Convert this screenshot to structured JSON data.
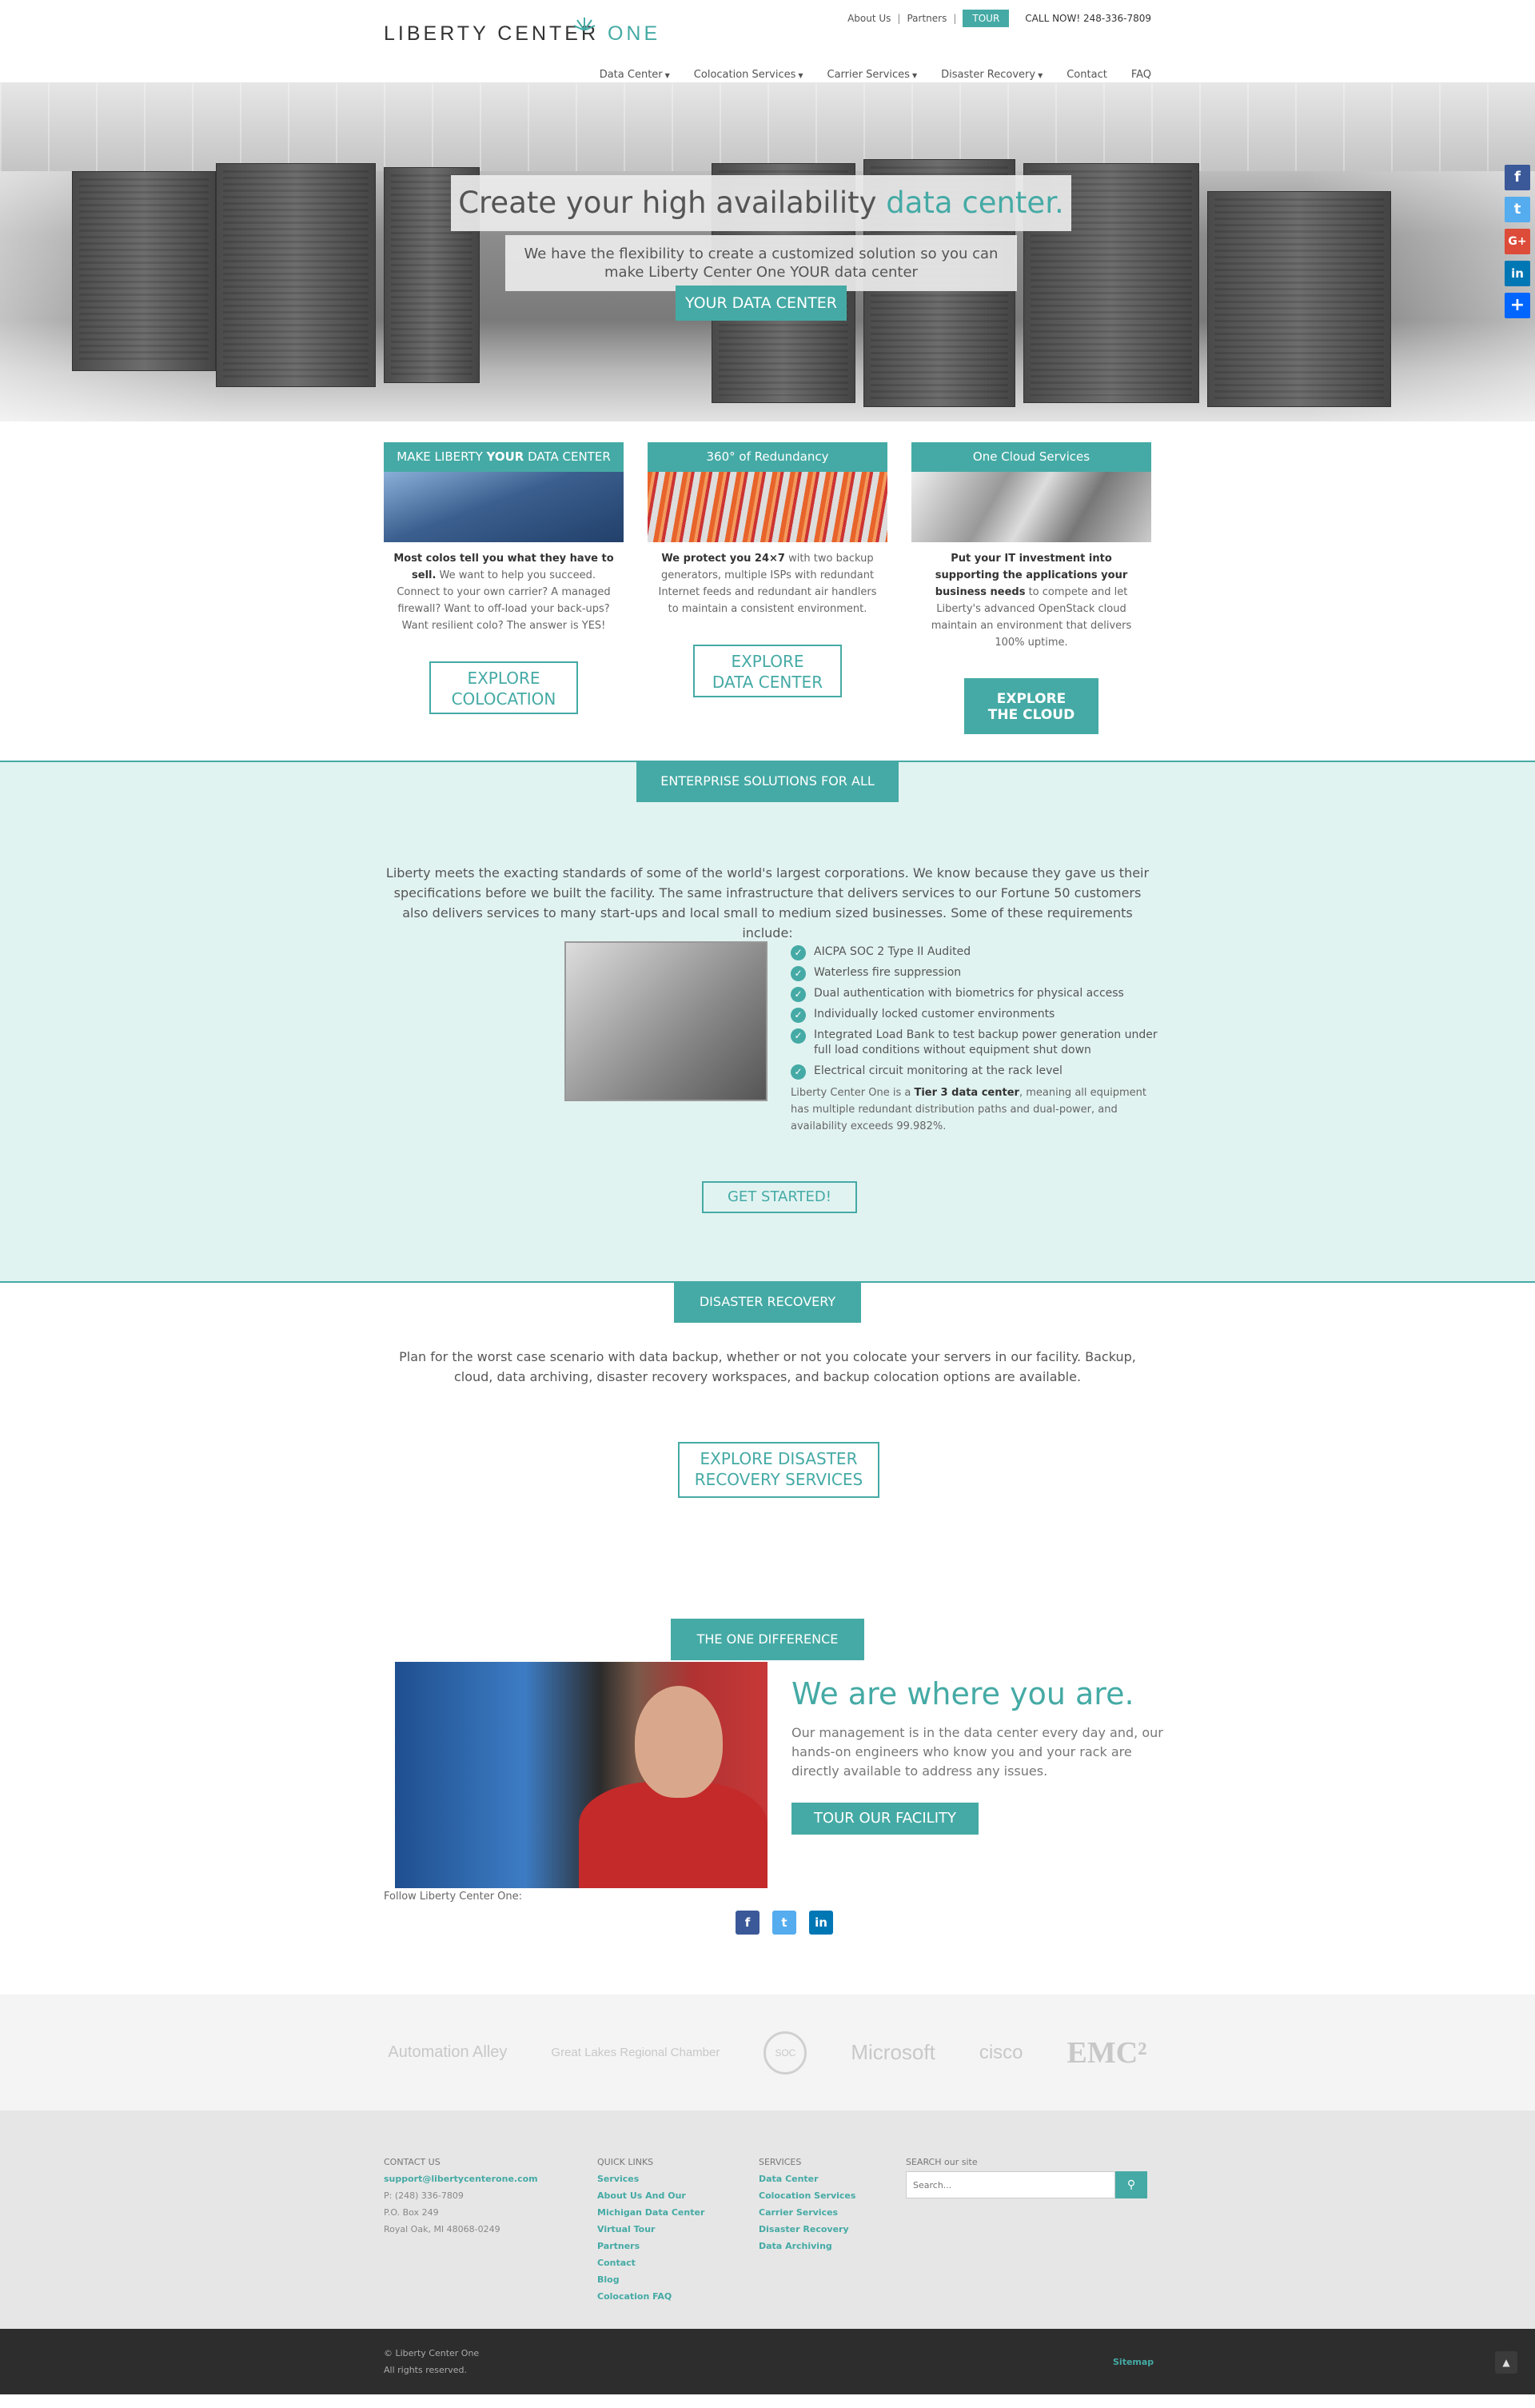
{
  "header": {
    "logo_text": "LIBERTY CENTER ",
    "logo_accent": "ONE",
    "toplinks": [
      "About Us",
      "Partners"
    ],
    "tour_label": "TOUR",
    "call": "CALL NOW! 248-336-7809",
    "nav": [
      {
        "label": "Data Center",
        "dropdown": true
      },
      {
        "label": "Colocation Services",
        "dropdown": true
      },
      {
        "label": "Carrier Services",
        "dropdown": true
      },
      {
        "label": "Disaster Recovery",
        "dropdown": true
      },
      {
        "label": "Contact",
        "dropdown": false
      },
      {
        "label": "FAQ",
        "dropdown": false
      }
    ]
  },
  "hero": {
    "title_main": "Create your high availability ",
    "title_accent": "data center.",
    "subtitle": "We have the flexibility to create a customized solution so you can make Liberty Center One YOUR data center",
    "button": "YOUR DATA CENTER"
  },
  "social_side": [
    "f",
    "t",
    "G+",
    "in",
    "+"
  ],
  "columns": [
    {
      "head_pre": "MAKE LIBERTY ",
      "head_bold": "YOUR",
      "head_post": " DATA CENTER",
      "bold_lead": "Most colos tell you what they have to sell.",
      "text": " We want to help you succeed. Connect to your own carrier? A managed firewall? Want to off-load your back-ups? Want resilient colo?  The answer is YES!",
      "btn1": "EXPLORE",
      "btn2": "COLOCATION"
    },
    {
      "head_pre": "360° of Redundancy",
      "head_bold": "",
      "head_post": "",
      "bold_lead": "We protect you 24×7",
      "text": " with two backup generators, multiple ISPs with redundant Internet feeds and redundant air handlers to maintain a consistent environment.",
      "btn1": "EXPLORE",
      "btn2": "DATA CENTER"
    },
    {
      "head_pre": "One Cloud Services",
      "head_bold": "",
      "head_post": "",
      "bold_lead": "Put your IT investment into supporting the applications your business needs",
      "text": " to compete and let Liberty's advanced OpenStack cloud maintain an environment that delivers 100% uptime.",
      "btn1": "EXPLORE",
      "btn2": "THE CLOUD"
    }
  ],
  "enterprise": {
    "tag": "ENTERPRISE SOLUTIONS FOR ALL",
    "text": "Liberty meets the exacting standards of some of the world's largest corporations. We know because they gave us their specifications before we built the facility. The same infrastructure that delivers services to our Fortune 50 customers also delivers services to many start-ups and local small to medium sized businesses. Some of these requirements include:",
    "list": [
      "AICPA SOC 2 Type II Audited",
      "Waterless fire suppression",
      "Dual authentication with biometrics for physical access",
      "Individually locked customer environments",
      "Integrated Load Bank to test backup power generation under full load conditions without equipment shut down",
      "Electrical circuit monitoring at the rack level"
    ],
    "note_pre": "Liberty Center One is a ",
    "note_bold": "Tier 3 data center",
    "note_post": ", meaning all equipment has multiple redundant distribution paths and dual-power, and availability exceeds 99.982%.",
    "button": "GET STARTED!"
  },
  "disaster": {
    "tag": "DISASTER RECOVERY",
    "text": "Plan for the worst case scenario with data backup, whether or not you colocate your servers in our facility. Backup, cloud, data archiving, disaster recovery workspaces, and backup colocation options are available.",
    "btn1": "EXPLORE DISASTER",
    "btn2": "RECOVERY SERVICES"
  },
  "difference": {
    "tag": "THE ONE DIFFERENCE",
    "heading": "We are where you are.",
    "text": "Our management is in the data center every day and, our hands-on engineers who know you and your rack are directly available to address any issues.",
    "button": "TOUR OUR FACILITY",
    "follow": "Follow Liberty Center One:",
    "icons": [
      "f",
      "t",
      "in"
    ]
  },
  "partners": [
    "Automation Alley",
    "Great Lakes Regional Chamber",
    "SOC",
    "Microsoft",
    "cisco",
    "EMC²"
  ],
  "footer": {
    "contact": {
      "heading": "CONTACT US",
      "email": "support@libertycenterone.com",
      "phone": "P: (248) 336-7809",
      "po": "P.O. Box 249",
      "city": "Royal Oak, MI 48068-0249"
    },
    "quick": {
      "heading": "QUICK LINKS",
      "links": [
        "Services",
        "About Us And Our",
        "Michigan Data Center",
        "Virtual Tour",
        "Partners",
        "Contact",
        "Blog",
        "Colocation FAQ"
      ]
    },
    "services": {
      "heading": "SERVICES",
      "links": [
        "Data Center",
        "Colocation Services",
        "Carrier Services",
        "Disaster Recovery",
        "Data Archiving"
      ]
    },
    "search": {
      "heading": "SEARCH our site",
      "placeholder": "Search..."
    }
  },
  "bottom": {
    "copyright": "© Liberty Center One",
    "rights": "All rights reserved.",
    "sitemap": "Sitemap"
  },
  "colors": {
    "accent": "#45aaa5",
    "light_bg": "#e1f3f1",
    "dark_footer": "#2d2d2d"
  }
}
